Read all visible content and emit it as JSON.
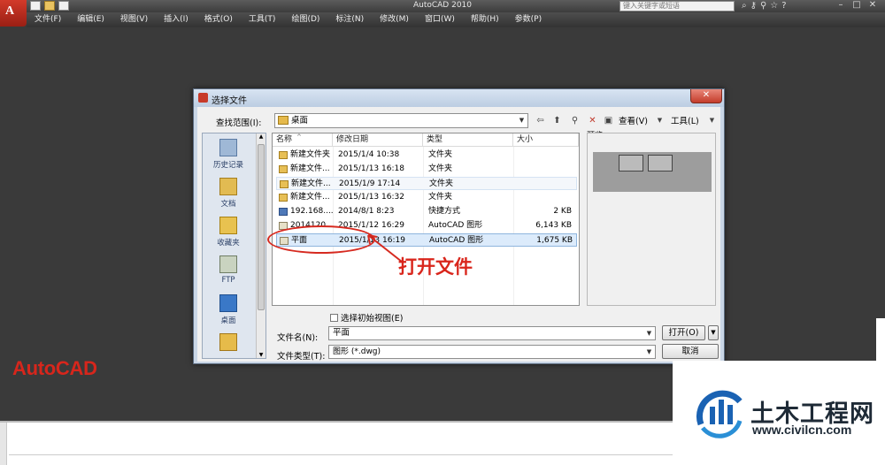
{
  "app": {
    "title": "AutoCAD 2010",
    "logo_text": "A",
    "brand": "AutoCAD",
    "help_search_placeholder": "键入关键字或短语"
  },
  "menu": [
    "文件(F)",
    "编辑(E)",
    "视图(V)",
    "插入(I)",
    "格式(O)",
    "工具(T)",
    "绘图(D)",
    "标注(N)",
    "修改(M)",
    "窗口(W)",
    "帮助(H)",
    "参数(P)"
  ],
  "dialog": {
    "title": "选择文件",
    "close_glyph": "✕",
    "look_in_label": "查找范围(I):",
    "look_in_value": "桌面",
    "views_label": "查看(V)",
    "tools_label": "工具(L)",
    "places": [
      "历史记录",
      "文档",
      "收藏夹",
      "FTP",
      "桌面"
    ],
    "columns": [
      "名称",
      "修改日期",
      "类型",
      "大小"
    ],
    "files": [
      {
        "name": "新建文件夹",
        "date": "2015/1/4 10:38",
        "type": "文件夹",
        "size": "",
        "icon": "folder"
      },
      {
        "name": "新建文件...",
        "date": "2015/1/13 16:18",
        "type": "文件夹",
        "size": "",
        "icon": "folder"
      },
      {
        "name": "新建文件...",
        "date": "2015/1/9 17:14",
        "type": "文件夹",
        "size": "",
        "icon": "folder"
      },
      {
        "name": "新建文件...",
        "date": "2015/1/13 16:32",
        "type": "文件夹",
        "size": "",
        "icon": "folder"
      },
      {
        "name": "192.168....",
        "date": "2014/8/1 8:23",
        "type": "快捷方式",
        "size": "2 KB",
        "icon": "link"
      },
      {
        "name": "2014120...",
        "date": "2015/1/12 16:29",
        "type": "AutoCAD 图形",
        "size": "6,143 KB",
        "icon": "dwg"
      },
      {
        "name": "平面",
        "date": "2015/1/13 16:19",
        "type": "AutoCAD 图形",
        "size": "1,675 KB",
        "icon": "dwg",
        "selected": true
      }
    ],
    "preview_label": "预览",
    "initial_view_label": "选择初始视图(E)",
    "file_name_label": "文件名(N):",
    "file_name_value": "平面",
    "file_type_label": "文件类型(T):",
    "file_type_value": "图形 (*.dwg)",
    "open_button": "打开(O)",
    "cancel_button": "取消"
  },
  "annotation": {
    "text": "打开文件",
    "color": "#d9261c"
  },
  "watermark": {
    "title": "土木工程网",
    "url": "www.civilcn.com"
  }
}
